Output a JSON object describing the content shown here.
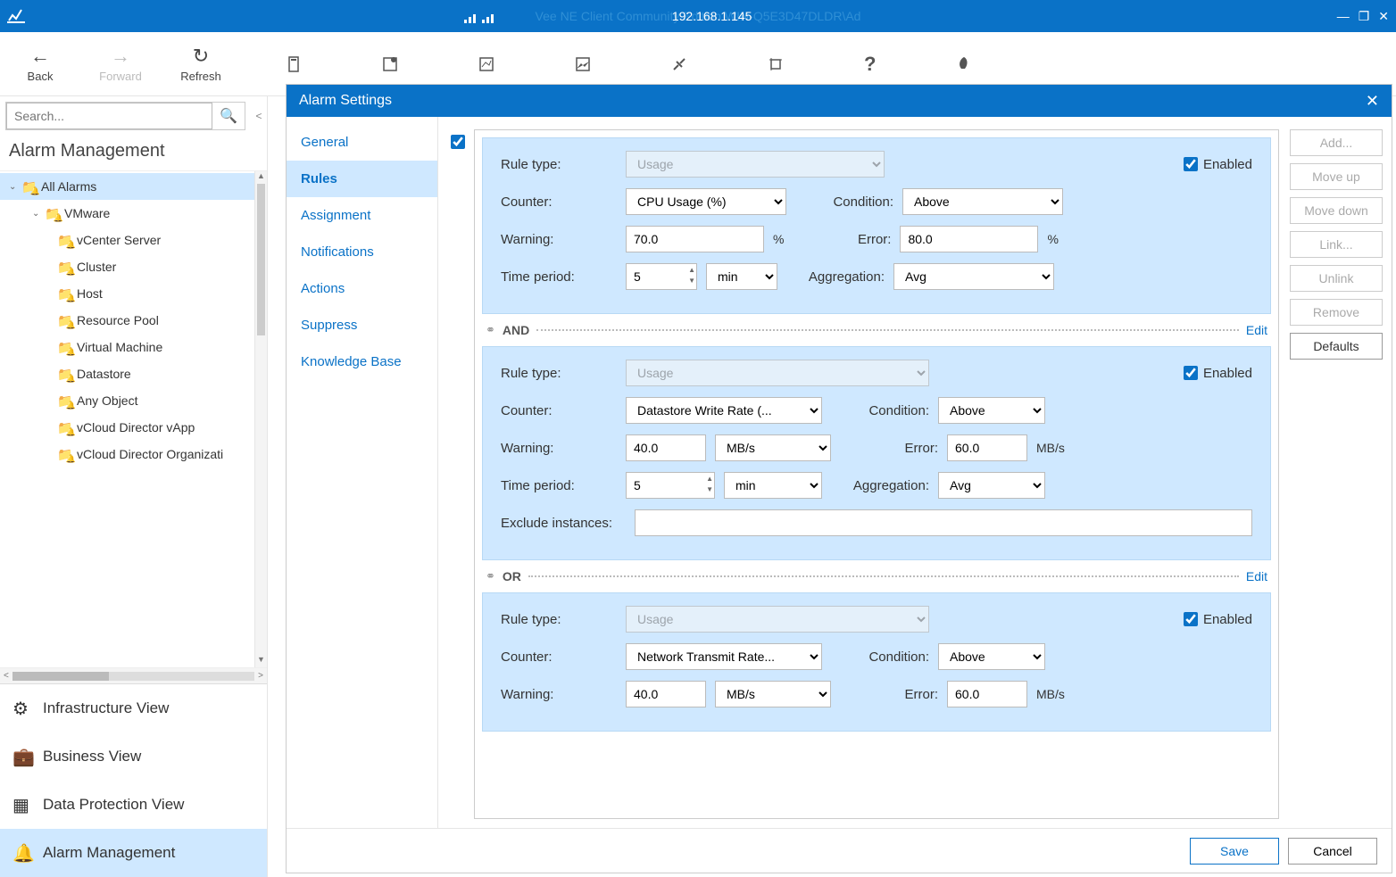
{
  "titlebar": {
    "ghost_text": "Vee      NE Client Community Edition               WIN-Q5E3D47DLDR\\Ad",
    "ip": "192.168.1.145"
  },
  "toolbar": {
    "back": "Back",
    "forward": "Forward",
    "refresh": "Refresh"
  },
  "search": {
    "placeholder": "Search..."
  },
  "left_heading": "Alarm Management",
  "tree": {
    "root": "All Alarms",
    "vmware": "VMware",
    "items": [
      "vCenter Server",
      "Cluster",
      "Host",
      "Resource Pool",
      "Virtual Machine",
      "Datastore",
      "Any Object",
      "vCloud Director vApp",
      "vCloud Director Organizati"
    ]
  },
  "views": {
    "infra": "Infrastructure View",
    "business": "Business View",
    "dataprotect": "Data Protection View",
    "alarm": "Alarm Management"
  },
  "dialog": {
    "title": "Alarm Settings",
    "nav": [
      "General",
      "Rules",
      "Assignment",
      "Notifications",
      "Actions",
      "Suppress",
      "Knowledge Base"
    ],
    "buttons": {
      "add": "Add...",
      "moveup": "Move up",
      "movedown": "Move down",
      "link": "Link...",
      "unlink": "Unlink",
      "remove": "Remove",
      "defaults": "Defaults"
    },
    "labels": {
      "rule_type": "Rule type:",
      "counter": "Counter:",
      "condition": "Condition:",
      "warning": "Warning:",
      "error": "Error:",
      "time_period": "Time period:",
      "aggregation": "Aggregation:",
      "enabled": "Enabled",
      "exclude": "Exclude instances:",
      "and": "AND",
      "or": "OR",
      "edit": "Edit"
    },
    "rule1": {
      "type": "Usage",
      "counter": "CPU Usage (%)",
      "condition": "Above",
      "warning": "70.0",
      "warning_unit": "%",
      "error": "80.0",
      "error_unit": "%",
      "period": "5",
      "period_unit": "min",
      "agg": "Avg"
    },
    "rule2": {
      "type": "Usage",
      "counter": "Datastore Write Rate (...",
      "condition": "Above",
      "warning": "40.0",
      "warning_unit": "MB/s",
      "error": "60.0",
      "error_unit": "MB/s",
      "period": "5",
      "period_unit": "min",
      "agg": "Avg",
      "exclude": ""
    },
    "rule3": {
      "type": "Usage",
      "counter": "Network Transmit Rate...",
      "condition": "Above",
      "warning": "40.0",
      "warning_unit": "MB/s",
      "error": "60.0",
      "error_unit": "MB/s"
    },
    "footer": {
      "save": "Save",
      "cancel": "Cancel"
    }
  }
}
